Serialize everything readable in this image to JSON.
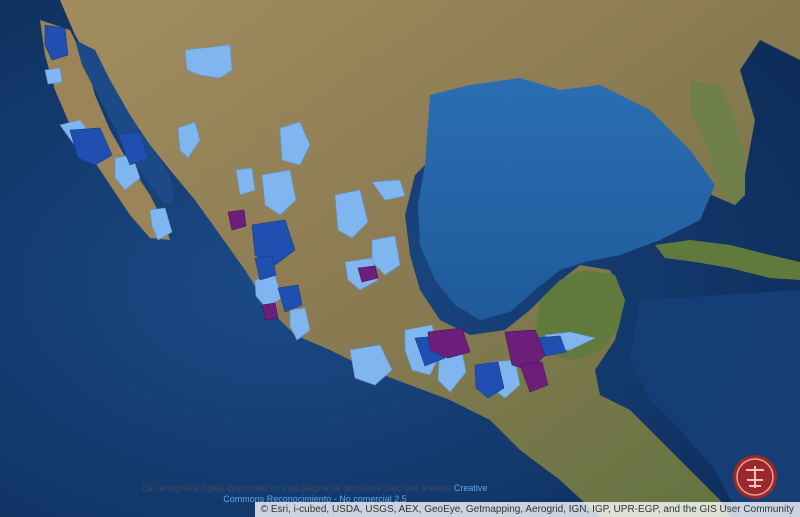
{
  "map": {
    "license_text": "La cartografía digital disponible en esta página se distribuye bajo una licencia",
    "license_link_part1": "Creative",
    "license_link_part2": "Commons Reconocimiento - No comercial 2.5",
    "attribution": "© Esri, i-cubed, USDA, USGS, AEX, GeoEye, Getmapping, Aerogrid, IGN, IGP, UPR-EGP, and the GIS User Community",
    "seal_text": "",
    "basemap": "satellite-imagery",
    "colors": {
      "ocean": "#1b4a86",
      "land": "#8a7a52",
      "light_blue_region": "#7fb6f0",
      "dark_blue_region": "#1f4fb0",
      "purple_region": "#6b1f7a",
      "seal_red": "#b3261e"
    }
  }
}
